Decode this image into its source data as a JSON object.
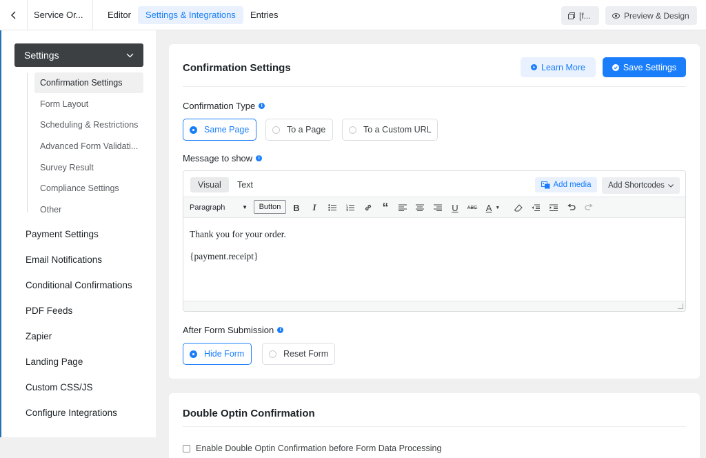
{
  "topbar": {
    "form_name": "Service Or...",
    "tabs": [
      "Editor",
      "Settings & Integrations",
      "Entries"
    ],
    "shortcode_label": "[f...",
    "preview_label": "Preview & Design"
  },
  "sidebar": {
    "settings_label": "Settings",
    "sub_items": [
      "Confirmation Settings",
      "Form Layout",
      "Scheduling & Restrictions",
      "Advanced Form Validati...",
      "Survey Result",
      "Compliance Settings",
      "Other"
    ],
    "main_items": [
      "Payment Settings",
      "Email Notifications",
      "Conditional Confirmations",
      "PDF Feeds",
      "Zapier",
      "Landing Page",
      "Custom CSS/JS",
      "Configure Integrations"
    ]
  },
  "confirmation": {
    "title": "Confirmation Settings",
    "learn_more": "Learn More",
    "save": "Save Settings",
    "type_label": "Confirmation Type",
    "type_options": [
      "Same Page",
      "To a Page",
      "To a Custom URL"
    ],
    "type_selected": "Same Page",
    "message_label": "Message to show",
    "editor": {
      "tab_visual": "Visual",
      "tab_text": "Text",
      "add_media": "Add media",
      "add_shortcodes": "Add Shortcodes",
      "format_select": "Paragraph",
      "button_label": "Button",
      "content_lines": [
        "Thank you for your order.",
        "{payment.receipt}"
      ]
    },
    "after_label": "After Form Submission",
    "after_options": [
      "Hide Form",
      "Reset Form"
    ],
    "after_selected": "Hide Form"
  },
  "double_optin": {
    "title": "Double Optin Confirmation",
    "checkbox_label": "Enable Double Optin Confirmation before Form Data Processing",
    "checked": false
  },
  "colors": {
    "accent": "#1a7efb",
    "sidebar_active": "#3c4043"
  }
}
